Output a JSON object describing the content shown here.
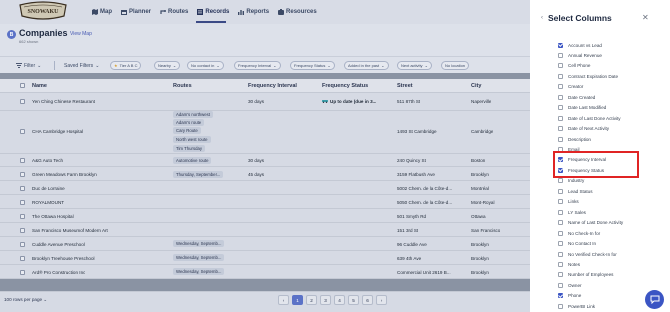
{
  "nav": {
    "logo_text": "SNOWAKU",
    "items": [
      {
        "label": "Map",
        "icon": "map-icon"
      },
      {
        "label": "Planner",
        "icon": "planner-icon"
      },
      {
        "label": "Routes",
        "icon": "routes-icon"
      },
      {
        "label": "Records",
        "icon": "records-icon",
        "active": true
      },
      {
        "label": "Reports",
        "icon": "reports-icon"
      },
      {
        "label": "Resources",
        "icon": "resources-icon"
      }
    ]
  },
  "header": {
    "badge": "B",
    "title": "Companies",
    "subtitle": "662 shown",
    "view_map": "View Map"
  },
  "filters": {
    "filter_label": "Filter",
    "saved_filters": "Saved Filters",
    "tier": "Tier A B C",
    "nearby": "Nearby",
    "no_contact": "No contact in",
    "frequency_interval": "Frequency Interval",
    "frequency_status": "Frequency Status",
    "added_in_past": "Added in the past",
    "next_activity": "Next activity",
    "no_location": "No location"
  },
  "table": {
    "headers": {
      "name": "Name",
      "routes": "Routes",
      "frequency_interval": "Frequency Interval",
      "frequency_status": "Frequency Status",
      "street": "Street",
      "city": "City"
    },
    "rows": [
      {
        "name": "Yen Ching Chinese Restaurant",
        "routes": [],
        "interval": "30 days",
        "status": "Up to date (due in 3...",
        "street": "511 87th St",
        "city": "Naperville"
      },
      {
        "name": "CHA Cambridge Hospital",
        "routes": [
          "Adam's northwest",
          "Adam's route",
          "Cary Route",
          "North west route",
          "Tim Thursday"
        ],
        "interval": "",
        "status": "",
        "street": "1493 St Cambridge",
        "city": "Cambridge"
      },
      {
        "name": "A&G Auto Tech",
        "routes": [
          "Automotive route"
        ],
        "interval": "30 days",
        "status": "",
        "street": "240 Quincy St",
        "city": "Boston"
      },
      {
        "name": "Green Meadows Farm Brooklyn",
        "routes": [
          "Thursday, September..."
        ],
        "interval": "45 days",
        "status": "",
        "street": "3159 Flatbush Ave",
        "city": "Brooklyn"
      },
      {
        "name": "Duc de Lorraine",
        "routes": [],
        "interval": "",
        "status": "",
        "street": "5002 Chem. de la Côte-d...",
        "city": "Montréal"
      },
      {
        "name": "ROYALMOUNT",
        "routes": [],
        "interval": "",
        "status": "",
        "street": "5050 Chem. de la Côte-d...",
        "city": "Mont-Royal"
      },
      {
        "name": "The Ottawa Hospital",
        "routes": [],
        "interval": "",
        "status": "",
        "street": "501 Smyth Rd",
        "city": "Ottawa"
      },
      {
        "name": "San Francisco Museumof Modern Art",
        "routes": [],
        "interval": "",
        "status": "",
        "street": "151 3rd St",
        "city": "San Francisco"
      },
      {
        "name": "Cuddle Avenue Preschool",
        "routes": [
          "Wednesday, Septemb..."
        ],
        "interval": "",
        "status": "",
        "street": "96 Cuddle Ave",
        "city": "Brooklyn"
      },
      {
        "name": "Brooklyn Treehouse Preschool",
        "routes": [
          "Wednesday, Septemb..."
        ],
        "interval": "",
        "status": "",
        "street": "639 4th Ave",
        "city": "Brooklyn"
      },
      {
        "name": "Ard® Pro Construction Inc",
        "routes": [
          "Wednesday, Septemb..."
        ],
        "interval": "",
        "status": "",
        "street": "Commercial Unit 2619 B...",
        "city": "Brooklyn"
      }
    ]
  },
  "footer": {
    "rows_per_page": "100 rows per page",
    "pages": [
      "1",
      "2",
      "3",
      "4",
      "5",
      "6"
    ],
    "current_page": "1"
  },
  "panel": {
    "title": "Select Columns",
    "columns": [
      {
        "label": "Account vs Lead",
        "checked": true
      },
      {
        "label": "Annual Revenue",
        "checked": false
      },
      {
        "label": "Cell Phone",
        "checked": false
      },
      {
        "label": "Contract Expiration Date",
        "checked": false
      },
      {
        "label": "Creator",
        "checked": false
      },
      {
        "label": "Date Created",
        "checked": false
      },
      {
        "label": "Date Last Modified",
        "checked": false
      },
      {
        "label": "Date of Last Done Activity",
        "checked": false
      },
      {
        "label": "Date of Next Activity",
        "checked": false
      },
      {
        "label": "Description",
        "checked": false
      },
      {
        "label": "Email",
        "checked": false
      },
      {
        "label": "Frequency Interval",
        "checked": true
      },
      {
        "label": "Frequency Status",
        "checked": true
      },
      {
        "label": "Industry",
        "checked": false
      },
      {
        "label": "Lead Status",
        "checked": false
      },
      {
        "label": "Links",
        "checked": false
      },
      {
        "label": "LY Sales",
        "checked": false
      },
      {
        "label": "Name of Last Done Activity",
        "checked": false
      },
      {
        "label": "No Check-In for",
        "checked": false
      },
      {
        "label": "No Contact In",
        "checked": false
      },
      {
        "label": "No Verified Check-In for",
        "checked": false
      },
      {
        "label": "Notes",
        "checked": false
      },
      {
        "label": "Number of Employees",
        "checked": false
      },
      {
        "label": "Owner",
        "checked": false
      },
      {
        "label": "Phone",
        "checked": true
      },
      {
        "label": "PowerBI Link",
        "checked": false
      }
    ]
  },
  "colors": {
    "accent": "#3b55c4",
    "highlight": "#e02424",
    "overlay": "#8a93a3"
  }
}
